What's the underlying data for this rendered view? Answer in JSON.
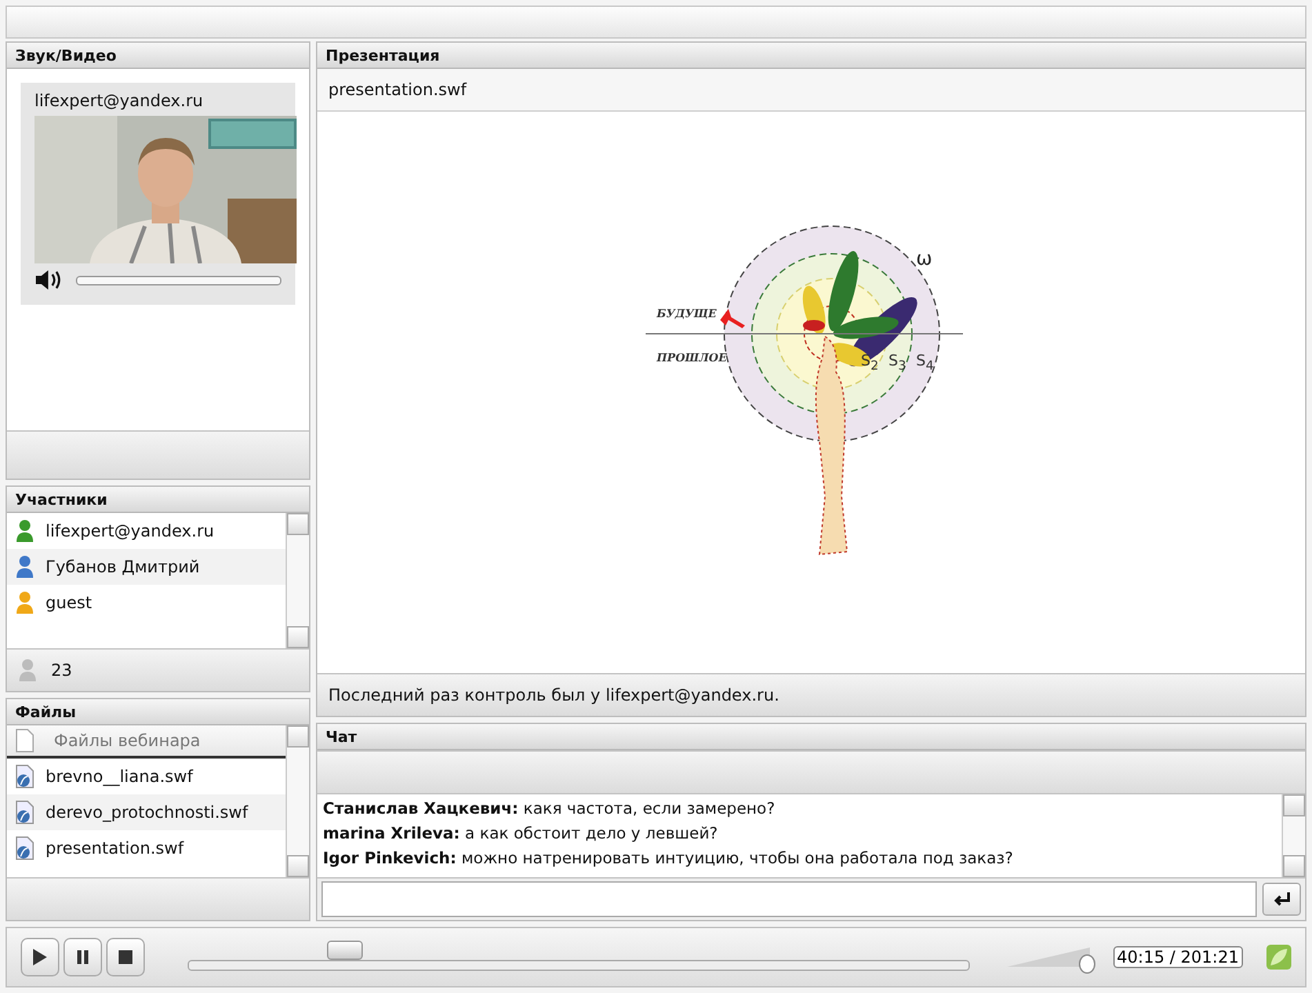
{
  "video": {
    "title": "Звук/Видео",
    "user": "lifexpert@yandex.ru",
    "volume": {
      "level": 0
    }
  },
  "participants": {
    "title": "Участники",
    "items": [
      {
        "name": "lifexpert@yandex.ru",
        "color": "#3a9a2c"
      },
      {
        "name": "Губанов Дмитрий",
        "color": "#3f78c8"
      },
      {
        "name": "guest",
        "color": "#f0a818"
      }
    ],
    "count": "23"
  },
  "files": {
    "title": "Файлы",
    "column": "Файлы вебинара",
    "items": [
      "brevno__liana.swf",
      "derevo_protochnosti.swf",
      "presentation.swf"
    ]
  },
  "presentation": {
    "title": "Презентация",
    "file": "presentation.swf",
    "slide": {
      "future": "БУДУЩЕ",
      "past": "ПРОШЛОЕ",
      "omega": "ω",
      "rings": [
        "S$_{2}$",
        "S$_{3}$",
        "S$_{4}$"
      ]
    },
    "status": "Последний раз контроль был у lifexpert@yandex.ru."
  },
  "chat": {
    "title": "Чат",
    "messages": [
      {
        "author": "Станислав Хацкевич:",
        "text": "какя частота, если замерено?"
      },
      {
        "author": "marina Xrileva:",
        "text": "а как обстоит дело у левшей?"
      },
      {
        "author": "Igor Pinkevich:",
        "text": "можно натренировать интуицию, чтобы она работала под заказ?"
      }
    ]
  },
  "player": {
    "level": 0.2,
    "volume": {
      "level": 0.95
    },
    "time": "40:15 / 201:21"
  }
}
